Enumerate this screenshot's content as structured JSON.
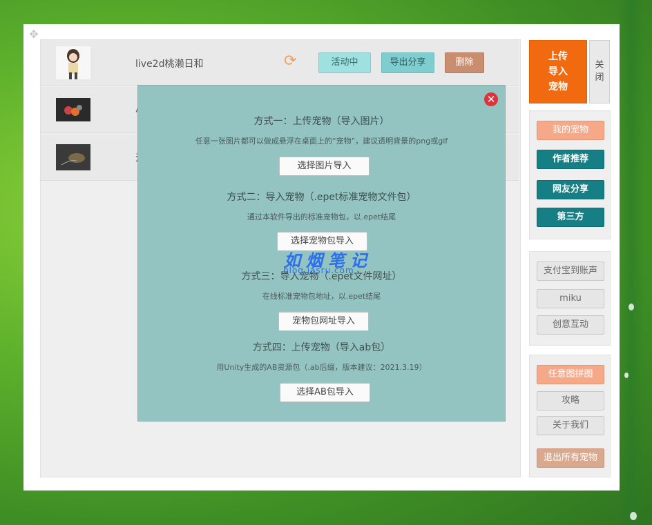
{
  "pets": [
    {
      "name": "live2d桃濑日和",
      "active_label": "活动中",
      "export_label": "导出分享",
      "delete_label": "删除"
    },
    {
      "name": "小"
    },
    {
      "name": "沙"
    }
  ],
  "sidebar": {
    "upload_label": "上传\n导入\n宠物",
    "close_label": "关\n闭",
    "categories": [
      "我的宠物",
      "作者推荐",
      "网友分享",
      "第三方"
    ],
    "group2": [
      "支付宝到账声",
      "miku",
      "创意互动"
    ],
    "group3": [
      "任意图拼图",
      "攻略",
      "关于我们",
      "退出所有宠物"
    ]
  },
  "modal": {
    "sections": [
      {
        "title": "方式一：上传宠物（导入图片）",
        "desc": "任意一张图片都可以做成悬浮在桌面上的“宠物”，建议透明背景的png或gif",
        "button": "选择图片导入"
      },
      {
        "title": "方式二：导入宠物（.epet标准宠物文件包）",
        "desc": "通过本软件导出的标准宠物包，以.epet结尾",
        "button": "选择宠物包导入"
      },
      {
        "title": "方式三：导入宠物（.epet文件网址）",
        "desc": "在线标准宠物包地址，以.epet结尾",
        "button": "宠物包网址导入"
      },
      {
        "title": "方式四：上传宠物（导入ab包）",
        "desc": "用Unity生成的AB资源包（.ab后缀，版本建议：2021.3.19）",
        "button": "选择AB包导入"
      }
    ],
    "close_icon": "close-icon"
  },
  "watermark": {
    "text": "如烟笔记",
    "sub": "blog.jasru.com"
  },
  "colors": {
    "accent": "#f26a10",
    "teal": "#167f85",
    "modal_bg": "#94c4c2"
  }
}
